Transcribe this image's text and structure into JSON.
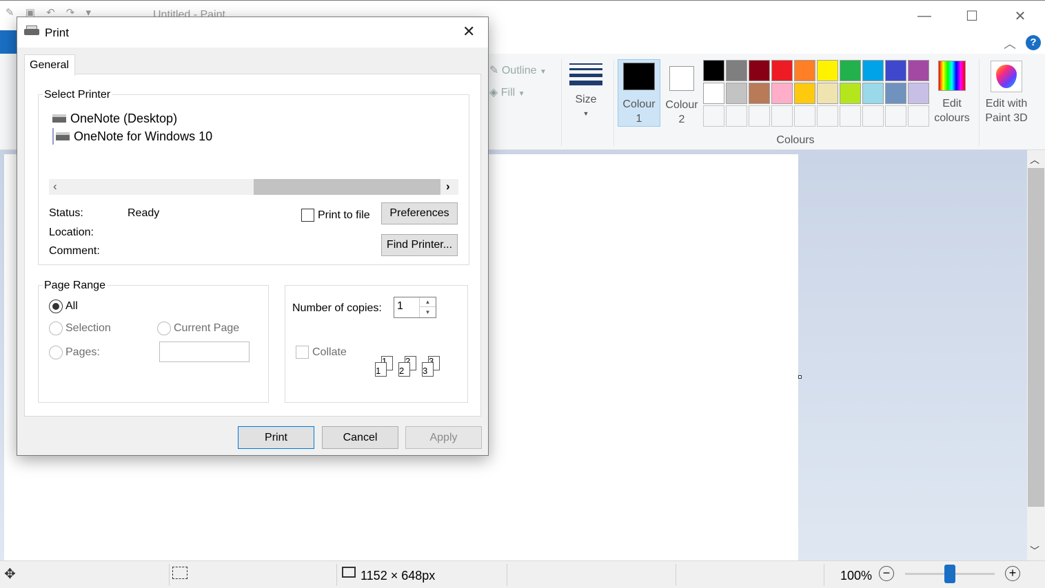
{
  "app": {
    "title": "Untitled - Paint",
    "window_controls": {
      "minimize": "—",
      "maximize": "☐",
      "close": "✕"
    }
  },
  "ribbon": {
    "outline_label": "Outline",
    "fill_label": "Fill",
    "size_label": "Size",
    "colour1_label": "Colour 1",
    "colour2_label": "Colour 2",
    "colours_group_label": "Colours",
    "edit_colours_label": "Edit colours",
    "edit_paint3d_label": "Edit with Paint 3D",
    "colour1_value": "#000000",
    "colour2_value": "#ffffff",
    "palette_row1": [
      "#000000",
      "#7f7f7f",
      "#880015",
      "#ed1c24",
      "#ff7f27",
      "#fff200",
      "#22b14c",
      "#00a2e8",
      "#3f48cc",
      "#a349a4"
    ],
    "palette_row2": [
      "#ffffff",
      "#c3c3c3",
      "#b97a57",
      "#ffaec9",
      "#ffc90e",
      "#efe4b0",
      "#b5e61d",
      "#99d9ea",
      "#7092be",
      "#c8bfe7"
    ]
  },
  "statusbar": {
    "image_size": "1152 × 648px",
    "zoom": "100%"
  },
  "dialog": {
    "title": "Print",
    "tab_general": "General",
    "select_printer_label": "Select Printer",
    "printers": [
      "OneNote (Desktop)",
      "OneNote for Windows 10"
    ],
    "status_label": "Status:",
    "status_value": "Ready",
    "location_label": "Location:",
    "comment_label": "Comment:",
    "print_to_file_label": "Print to file",
    "preferences_label": "Preferences",
    "find_printer_label": "Find Printer...",
    "page_range_label": "Page Range",
    "range_all": "All",
    "range_selection": "Selection",
    "range_current_page": "Current Page",
    "range_pages": "Pages:",
    "copies_label": "Number of copies:",
    "copies_value": "1",
    "collate_label": "Collate",
    "print_button": "Print",
    "cancel_button": "Cancel",
    "apply_button": "Apply"
  }
}
